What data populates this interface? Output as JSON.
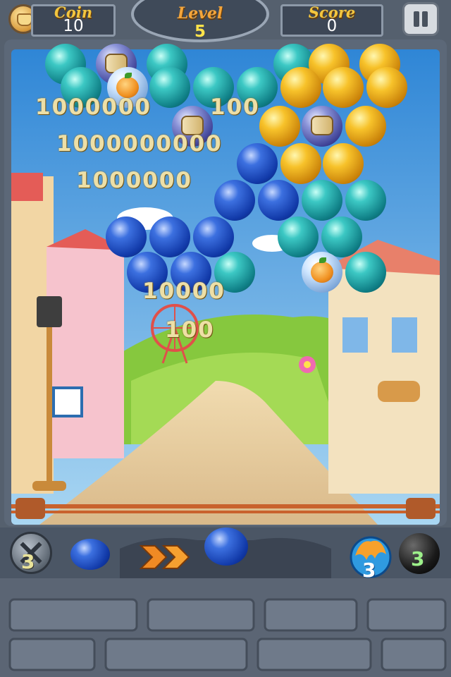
{
  "hud": {
    "coin_label": "Coin",
    "coin_value": "10",
    "level_label": "Level",
    "level_value": "5",
    "score_label": "Score",
    "score_value": "0"
  },
  "score_popups": [
    "1000000",
    "100",
    "1000000000",
    "1000000",
    "10000",
    "100"
  ],
  "bubble_grid": [
    {
      "color": "teal"
    },
    {
      "color": "clear-drum"
    },
    {
      "color": "teal"
    },
    {
      "color": "teal"
    },
    {
      "color": "yellow"
    },
    {
      "color": "yellow"
    },
    {
      "color": "teal"
    },
    {
      "color": "clear-fruit"
    },
    {
      "color": "teal"
    },
    {
      "color": "teal"
    },
    {
      "color": "teal"
    },
    {
      "color": "yellow"
    },
    {
      "color": "yellow"
    },
    {
      "color": "yellow"
    },
    {
      "color": "navy-drum"
    },
    {
      "color": "yellow"
    },
    {
      "color": "navy-drum"
    },
    {
      "color": "yellow"
    },
    {
      "color": "blue"
    },
    {
      "color": "yellow"
    },
    {
      "color": "yellow"
    },
    {
      "color": "blue"
    },
    {
      "color": "blue"
    },
    {
      "color": "teal"
    },
    {
      "color": "teal"
    },
    {
      "color": "blue"
    },
    {
      "color": "blue"
    },
    {
      "color": "blue"
    },
    {
      "color": "teal"
    },
    {
      "color": "teal"
    },
    {
      "color": "blue"
    },
    {
      "color": "blue"
    },
    {
      "color": "teal"
    },
    {
      "color": "clear-fruit"
    },
    {
      "color": "teal"
    }
  ],
  "shooter": {
    "next_bubble": "blue",
    "current_bubble": "blue",
    "swap_count": "3",
    "fire_count": "3",
    "bomb_count": "3"
  },
  "icons": [
    "coin-icon",
    "pause-icon",
    "swap-icon",
    "double-arrow-icon",
    "fire-bubble-icon",
    "bomb-icon"
  ],
  "colors": {
    "hud_label": "#f3c63f",
    "level_label": "#f4a53a",
    "level_value": "#ffe34a",
    "frame": "#5c6878",
    "sky": "#4fa6e6",
    "grass": "#8fd24a"
  }
}
